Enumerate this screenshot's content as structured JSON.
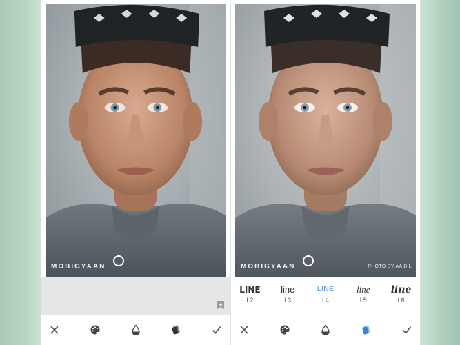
{
  "left_panel": {
    "watermark": "MOBIGYAAN"
  },
  "right_panel": {
    "watermark": "MOBIGYAAN",
    "photo_credit": "PHOTO BY AA DIL",
    "styles": [
      {
        "name": "LINE",
        "code": "L2",
        "selected": false
      },
      {
        "name": "line",
        "code": "L3",
        "selected": false
      },
      {
        "name": "LINE",
        "code": "L4",
        "selected": true
      },
      {
        "name": "line",
        "code": "L5",
        "selected": false
      },
      {
        "name": "line",
        "code": "L6",
        "selected": false
      }
    ]
  },
  "toolbar_icons": [
    "close-icon",
    "palette-icon",
    "drop-icon",
    "layers-icon",
    "check-icon"
  ],
  "colors": {
    "accent": "#4a8fd6",
    "toolbar_bg": "#ffffff",
    "panel_gray": "#e6e6e6"
  }
}
